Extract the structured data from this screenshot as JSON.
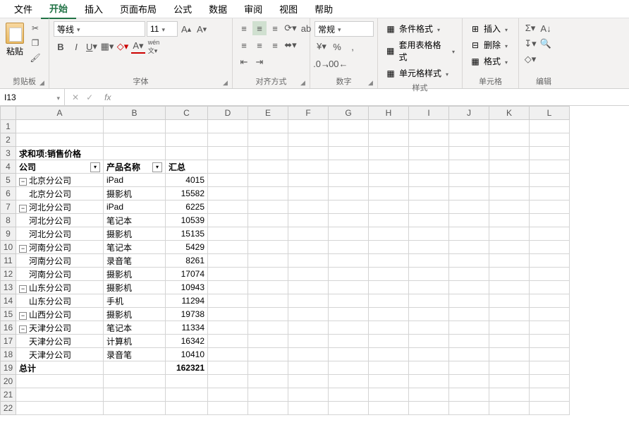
{
  "menu": {
    "tabs": [
      "文件",
      "开始",
      "插入",
      "页面布局",
      "公式",
      "数据",
      "审阅",
      "视图",
      "帮助"
    ],
    "active": "开始"
  },
  "ribbon": {
    "clipboard": {
      "paste": "粘贴",
      "label": "剪贴板"
    },
    "font": {
      "name": "等线",
      "size": "11",
      "label": "字体"
    },
    "align": {
      "label": "对齐方式"
    },
    "number": {
      "format": "常规",
      "label": "数字"
    },
    "styles": {
      "cond": "条件格式",
      "table": "套用表格格式",
      "cell": "单元格样式",
      "label": "样式"
    },
    "cells": {
      "insert": "插入",
      "delete": "删除",
      "format": "格式",
      "label": "单元格"
    },
    "edit": {
      "label": "编辑"
    }
  },
  "namebox": "I13",
  "cols": [
    "A",
    "B",
    "C",
    "D",
    "E",
    "F",
    "G",
    "H",
    "I",
    "J",
    "K",
    "L"
  ],
  "pivot": {
    "title": "求和项:销售价格",
    "h1": "公司",
    "h2": "产品名称",
    "h3": "汇总",
    "rows": [
      {
        "exp": true,
        "c": "北京分公司",
        "p": "iPad",
        "v": "4015"
      },
      {
        "c": "北京分公司",
        "p": "摄影机",
        "v": "15582"
      },
      {
        "exp": true,
        "c": "河北分公司",
        "p": "iPad",
        "v": "6225"
      },
      {
        "c": "河北分公司",
        "p": "笔记本",
        "v": "10539"
      },
      {
        "c": "河北分公司",
        "p": "摄影机",
        "v": "15135"
      },
      {
        "exp": true,
        "c": "河南分公司",
        "p": "笔记本",
        "v": "5429"
      },
      {
        "c": "河南分公司",
        "p": "录音笔",
        "v": "8261"
      },
      {
        "c": "河南分公司",
        "p": "摄影机",
        "v": "17074"
      },
      {
        "exp": true,
        "c": "山东分公司",
        "p": "摄影机",
        "v": "10943"
      },
      {
        "c": "山东分公司",
        "p": "手机",
        "v": "11294"
      },
      {
        "exp": true,
        "c": "山西分公司",
        "p": "摄影机",
        "v": "19738"
      },
      {
        "exp": true,
        "c": "天津分公司",
        "p": "笔记本",
        "v": "11334"
      },
      {
        "c": "天津分公司",
        "p": "计算机",
        "v": "16342"
      },
      {
        "c": "天津分公司",
        "p": "录音笔",
        "v": "10410"
      }
    ],
    "total_label": "总计",
    "total": "162321"
  }
}
